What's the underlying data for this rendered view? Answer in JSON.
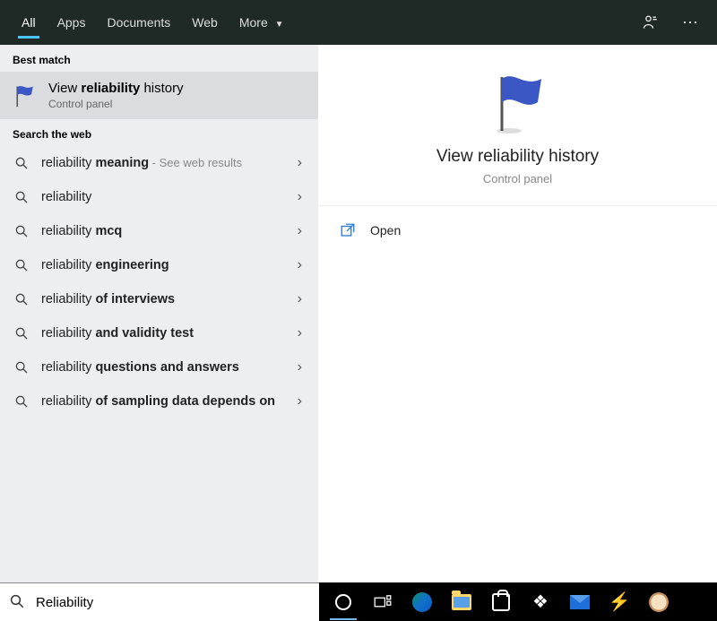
{
  "tabs": {
    "items": [
      "All",
      "Apps",
      "Documents",
      "Web",
      "More"
    ],
    "active_index": 0
  },
  "left": {
    "best_match_header": "Best match",
    "best_match": {
      "title_prefix": "View ",
      "title_bold": "reliability",
      "title_suffix": " history",
      "subtitle": "Control panel"
    },
    "web_header": "Search the web",
    "web_items": [
      {
        "prefix": "reliability ",
        "bold": "meaning",
        "suffix": "",
        "extra": " - See web results"
      },
      {
        "prefix": "reliability",
        "bold": "",
        "suffix": "",
        "extra": ""
      },
      {
        "prefix": "reliability ",
        "bold": "mcq",
        "suffix": "",
        "extra": ""
      },
      {
        "prefix": "reliability ",
        "bold": "engineering",
        "suffix": "",
        "extra": ""
      },
      {
        "prefix": "reliability ",
        "bold": "of interviews",
        "suffix": "",
        "extra": ""
      },
      {
        "prefix": "reliability ",
        "bold": "and validity test",
        "suffix": "",
        "extra": ""
      },
      {
        "prefix": "reliability ",
        "bold": "questions and answers",
        "suffix": "",
        "extra": ""
      },
      {
        "prefix": "reliability ",
        "bold": "of sampling data depends on",
        "suffix": "",
        "extra": ""
      }
    ]
  },
  "preview": {
    "title": "View reliability history",
    "subtitle": "Control panel",
    "open_label": "Open"
  },
  "search": {
    "value": "Reliability"
  }
}
